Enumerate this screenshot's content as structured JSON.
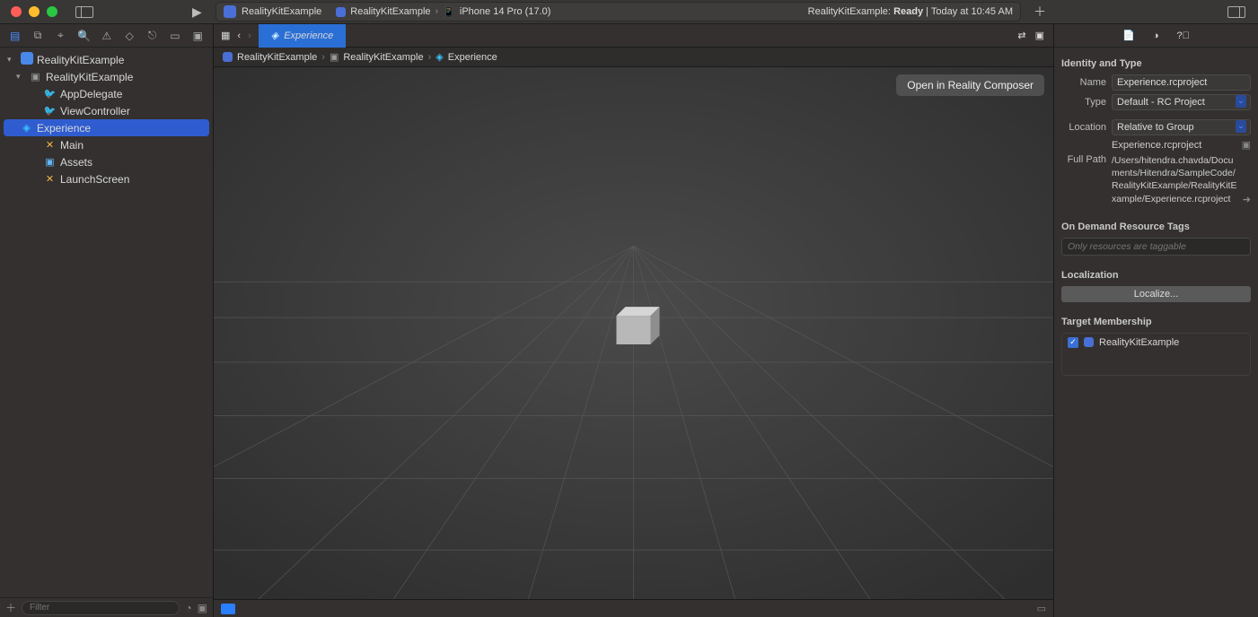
{
  "titlebar": {
    "project": "RealityKitExample",
    "scheme_target": "RealityKitExample",
    "scheme_device": "iPhone 14 Pro (17.0)",
    "status_prefix": "RealityKitExample:",
    "status_state": "Ready",
    "status_time": "Today at 10:45 AM"
  },
  "navigator": {
    "items": [
      {
        "label": "RealityKitExample",
        "icon": "proj",
        "indent": 0,
        "expanded": true
      },
      {
        "label": "RealityKitExample",
        "icon": "folder",
        "indent": 1,
        "expanded": true
      },
      {
        "label": "AppDelegate",
        "icon": "swift",
        "indent": 2
      },
      {
        "label": "ViewController",
        "icon": "swift",
        "indent": 2
      },
      {
        "label": "Experience",
        "icon": "rc",
        "indent": 2,
        "selected": true
      },
      {
        "label": "Main",
        "icon": "xib",
        "indent": 2
      },
      {
        "label": "Assets",
        "icon": "assets",
        "indent": 2
      },
      {
        "label": "LaunchScreen",
        "icon": "xib",
        "indent": 2
      }
    ],
    "filter_placeholder": "Filter"
  },
  "editor": {
    "tab_label": "Experience",
    "jumpbar": [
      "RealityKitExample",
      "RealityKitExample",
      "Experience"
    ],
    "open_composer": "Open in Reality Composer"
  },
  "inspector": {
    "identity_title": "Identity and Type",
    "name_label": "Name",
    "name_value": "Experience.rcproject",
    "type_label": "Type",
    "type_value": "Default - RC Project",
    "location_label": "Location",
    "location_value": "Relative to Group",
    "location_file": "Experience.rcproject",
    "fullpath_label": "Full Path",
    "fullpath_value": "/Users/hitendra.chavda/Documents/Hitendra/SampleCode/RealityKitExample/RealityKitExample/Experience.rcproject",
    "tags_title": "On Demand Resource Tags",
    "tags_placeholder": "Only resources are taggable",
    "localization_title": "Localization",
    "localize_button": "Localize...",
    "target_title": "Target Membership",
    "target_name": "RealityKitExample"
  }
}
